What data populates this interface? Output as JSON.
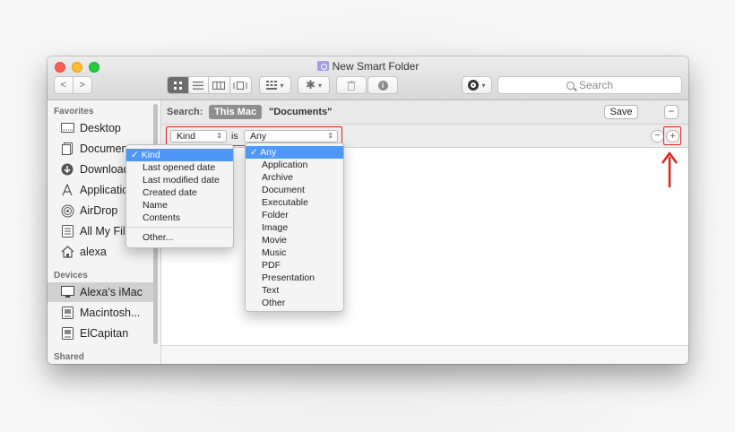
{
  "window": {
    "title": "New Smart Folder"
  },
  "toolbar": {
    "back": "<",
    "forward": ">",
    "search_placeholder": "Search"
  },
  "sidebar": {
    "favorites_header": "Favorites",
    "favorites": [
      {
        "label": "Desktop",
        "icon": "desktop-icon"
      },
      {
        "label": "Documents",
        "icon": "documents-icon"
      },
      {
        "label": "Downloads",
        "icon": "downloads-icon"
      },
      {
        "label": "Applications",
        "icon": "applications-icon"
      },
      {
        "label": "AirDrop",
        "icon": "airdrop-icon"
      },
      {
        "label": "All My Files",
        "icon": "all-my-files-icon"
      },
      {
        "label": "alexa",
        "icon": "home-icon"
      }
    ],
    "devices_header": "Devices",
    "devices": [
      {
        "label": "Alexa’s iMac",
        "icon": "imac-icon",
        "selected": true
      },
      {
        "label": "Macintosh...",
        "icon": "disk-icon"
      },
      {
        "label": "ElCapitan",
        "icon": "disk-icon"
      }
    ],
    "shared_header": "Shared"
  },
  "searchbar": {
    "search_label": "Search:",
    "scope_this_mac": "This Mac",
    "scope_documents": "\"Documents\"",
    "save_label": "Save",
    "minus": "−"
  },
  "criteria": {
    "attribute": "Kind",
    "operator": "is",
    "value": "Any",
    "minus": "−",
    "plus": "+"
  },
  "attribute_menu": {
    "items": [
      "Kind",
      "Last opened date",
      "Last modified date",
      "Created date",
      "Name",
      "Contents"
    ],
    "selected": "Kind",
    "other": "Other..."
  },
  "value_menu": {
    "items": [
      "Any",
      "Application",
      "Archive",
      "Document",
      "Executable",
      "Folder",
      "Image",
      "Movie",
      "Music",
      "PDF",
      "Presentation",
      "Text",
      "Other"
    ],
    "selected": "Any"
  },
  "colors": {
    "highlight": "#4f97f7",
    "annotation_red": "#e0241c"
  }
}
